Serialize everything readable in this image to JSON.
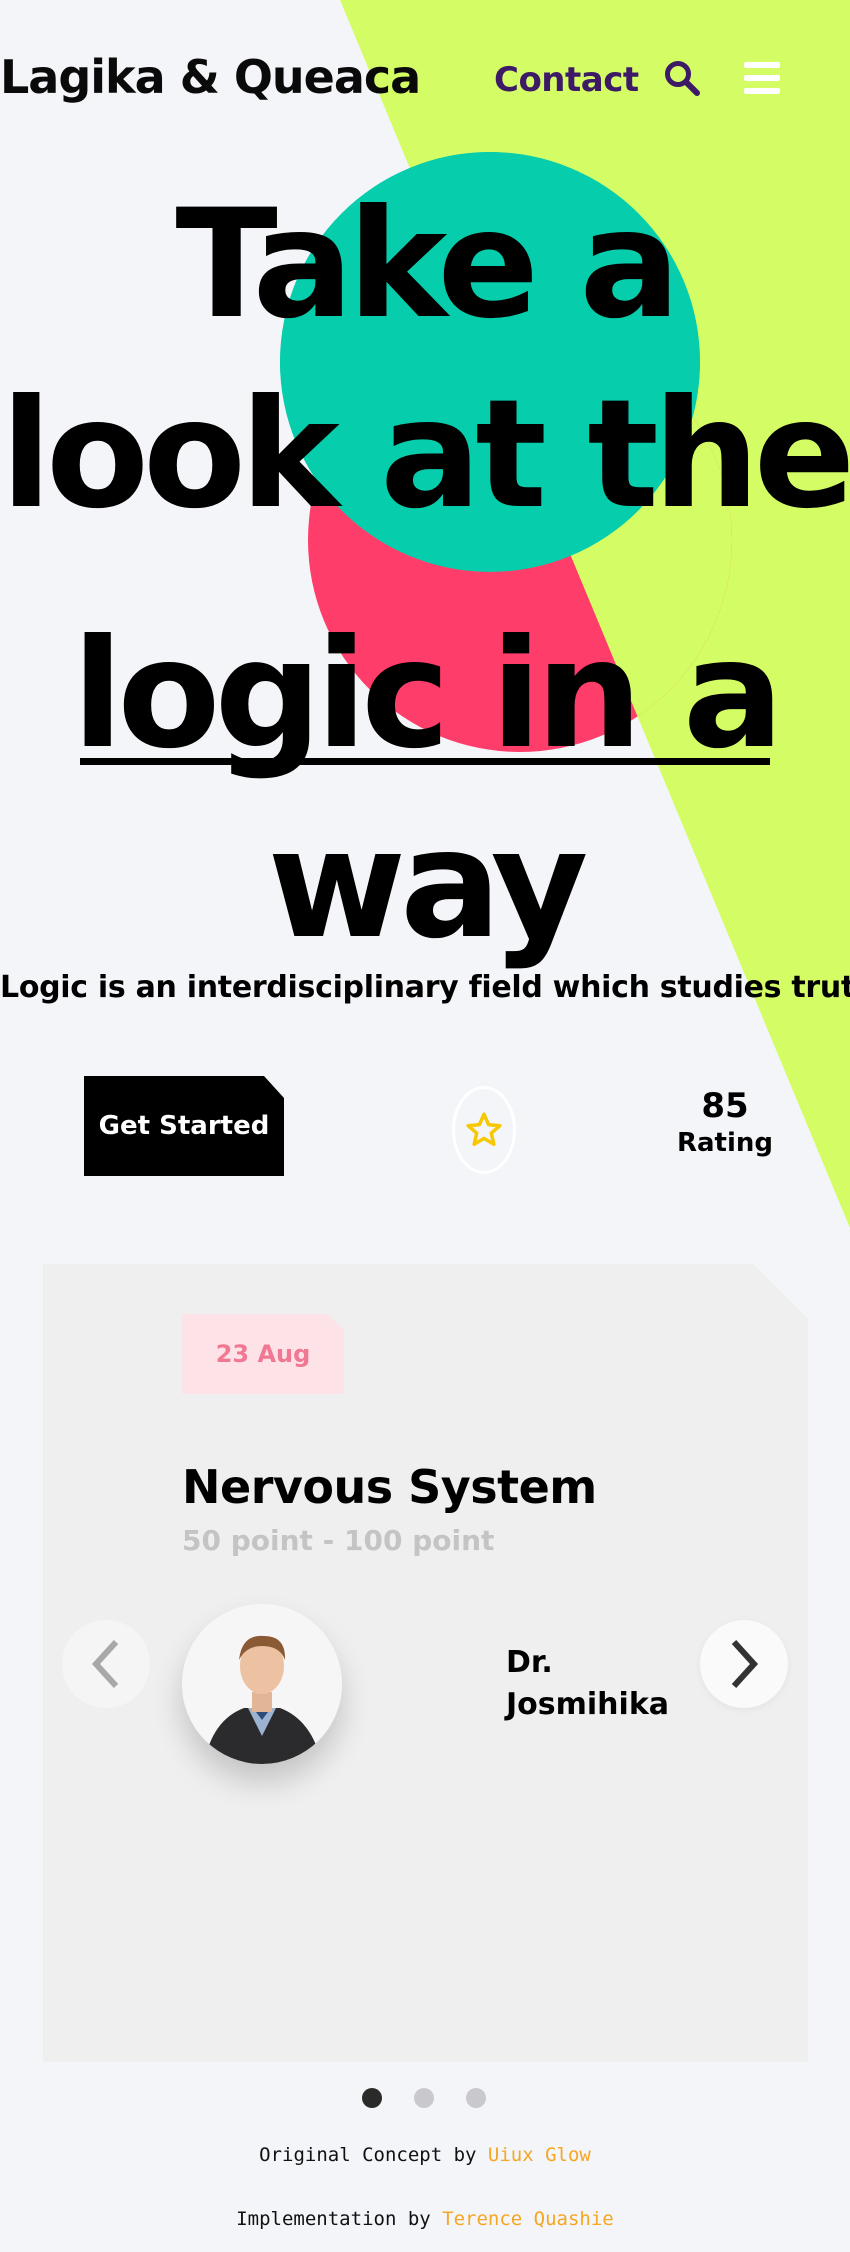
{
  "colors": {
    "background": "#f4f5f9",
    "lime": "#d4fd65",
    "teal": "#06cdac",
    "pink": "#ff3d6a",
    "contact": "#3d1a66",
    "credit_link": "#f5a623",
    "star": "#f5c800"
  },
  "header": {
    "brand": "Lagika & Queaca",
    "contact_label": "Contact",
    "search_icon": "search-icon",
    "menu_icon": "hamburger-menu-icon"
  },
  "hero": {
    "line1": "Take a",
    "line2": "look at the",
    "line3": "logic in a",
    "line4": "way",
    "subtitle": "Logic is an interdisciplinary field which studies truth"
  },
  "cta": {
    "get_started": "Get Started",
    "star_icon": "star-icon",
    "rating_value": "85",
    "rating_label": "Rating"
  },
  "card": {
    "date": "23 Aug",
    "title": "Nervous System",
    "points": "50 point - 100 point",
    "doctor_line1": "Dr.",
    "doctor_line2": "Josmihika"
  },
  "carousel": {
    "prev_icon": "chevron-left-icon",
    "next_icon": "chevron-right-icon",
    "page_count": 3,
    "active_page": 1
  },
  "footer": {
    "original_prefix": "Original Concept by",
    "original_author": "Uiux Glow",
    "impl_prefix": "Implementation by",
    "impl_author": "Terence Quashie"
  }
}
